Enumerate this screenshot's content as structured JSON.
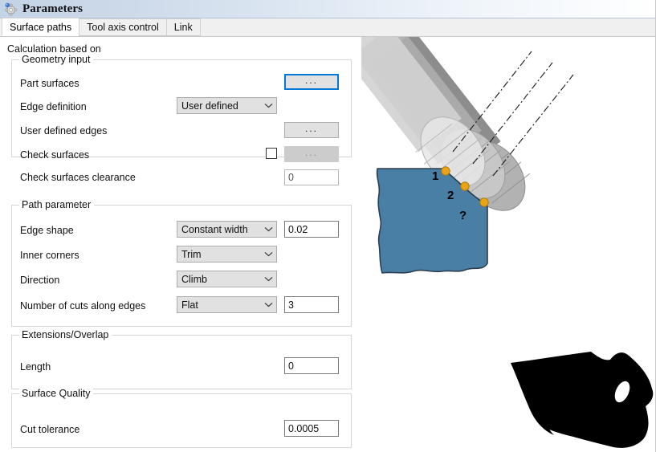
{
  "window": {
    "title": "Parameters",
    "icon": "gear-icon"
  },
  "tabs": [
    {
      "label": "Surface paths",
      "active": true
    },
    {
      "label": "Tool axis control",
      "active": false
    },
    {
      "label": "Link",
      "active": false
    }
  ],
  "form": {
    "calculation_based_on": "Calculation based on",
    "groups": {
      "geometry_input": {
        "title": "Geometry input",
        "rows": {
          "part_surfaces": {
            "label": "Part surfaces",
            "button": "..."
          },
          "edge_definition": {
            "label": "Edge definition",
            "value": "User defined"
          },
          "user_defined_edges": {
            "label": "User defined edges",
            "button": "..."
          },
          "check_surfaces": {
            "label": "Check surfaces",
            "button": "...",
            "checked": false
          },
          "check_surfaces_clearance": {
            "label": "Check surfaces clearance",
            "value": "0"
          }
        }
      },
      "path_parameter": {
        "title": "Path parameter",
        "rows": {
          "edge_shape": {
            "label": "Edge shape",
            "value": "Constant width",
            "number": "0.02"
          },
          "inner_corners": {
            "label": "Inner corners",
            "value": "Trim"
          },
          "direction": {
            "label": "Direction",
            "value": "Climb"
          },
          "number_of_cuts": {
            "label": "Number of cuts along edges",
            "value": "Flat",
            "number": "3"
          }
        }
      },
      "extensions_overlap": {
        "title": "Extensions/Overlap",
        "rows": {
          "length": {
            "label": "Length",
            "value": "0"
          }
        }
      },
      "surface_quality": {
        "title": "Surface Quality",
        "rows": {
          "cut_tolerance": {
            "label": "Cut tolerance",
            "value": "0.0005"
          }
        }
      }
    }
  },
  "illustration": {
    "contact_labels": [
      "1",
      "2",
      "?"
    ],
    "colors": {
      "part_fill": "#4a7fa5",
      "part_stroke": "#2c3e50",
      "contact_point": "#e8a317",
      "contact_point_stroke": "#b07d0c",
      "shank_light": "#cfcfcf",
      "shank_medium": "#a8a8a8",
      "shank_dark": "#868686",
      "ball_light": "#e8e8e8",
      "ball_medium": "#c8c8c8",
      "ball_dark": "#b0b0b0",
      "silhouette": "#000000"
    }
  },
  "theme": {
    "accent": "#0078d7",
    "control_face": "#e1e1e1",
    "disabled_face": "#cccccc",
    "group_border": "#d6d6d6"
  }
}
